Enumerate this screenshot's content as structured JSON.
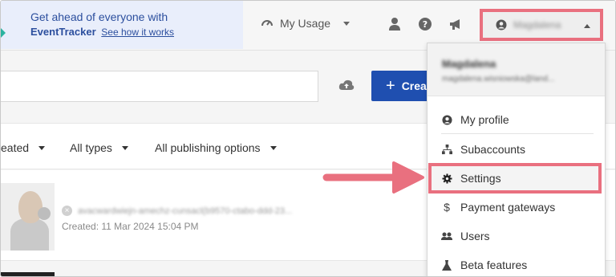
{
  "promo": {
    "line1": "Get ahead of everyone with",
    "brand": "EventTracker",
    "link": "See how it works"
  },
  "header": {
    "usage_label": "My Usage",
    "account_name": "Magdalena"
  },
  "toolbar": {
    "create_label": "Crea",
    "create_plus": "+"
  },
  "filters": {
    "created": "eated",
    "types": "All types",
    "publishing": "All publishing options"
  },
  "list": {
    "item_url": "avacwardwiejn-amechz-cunsacl(b9570-ctabo-ddd-23...",
    "created_text": "Created: 11 Mar 2024 15:04 PM",
    "remove_glyph": "×"
  },
  "account_menu": {
    "user_name": "Magdalena",
    "user_email": "magdalena.wisniowska@land...",
    "items": [
      {
        "label": "My profile",
        "icon": "user-circle-icon"
      },
      {
        "label": "Subaccounts",
        "icon": "sitemap-icon"
      },
      {
        "label": "Settings",
        "icon": "gear-icon"
      },
      {
        "label": "Payment gateways",
        "icon": "dollar-icon"
      },
      {
        "label": "Users",
        "icon": "users-icon"
      },
      {
        "label": "Beta features",
        "icon": "flask-icon"
      }
    ]
  },
  "colors": {
    "highlight": "#e9707f",
    "primary": "#1f4fb0",
    "promo_bg": "#e9eefb"
  }
}
